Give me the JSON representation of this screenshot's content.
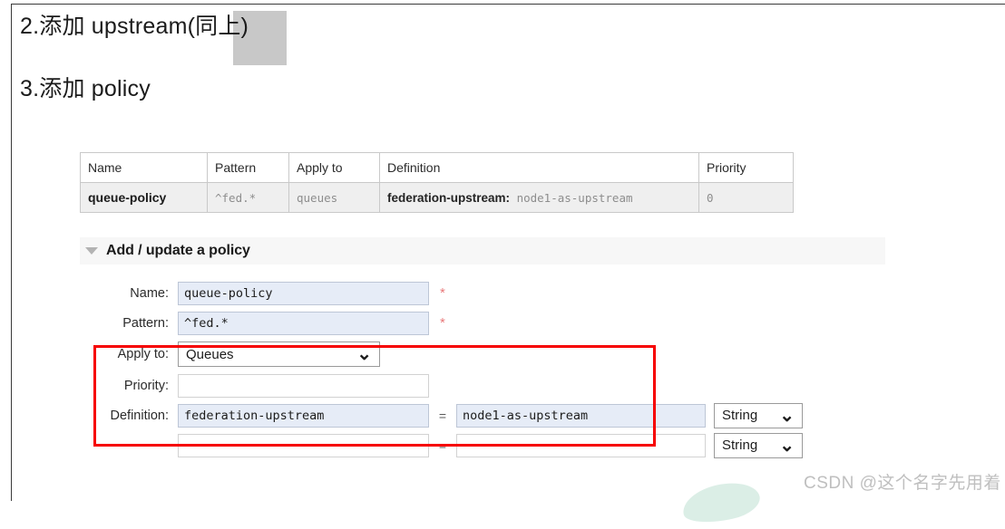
{
  "document": {
    "heading_2": "2.添加 upstream(同上)",
    "heading_2_highlight": "同上",
    "heading_3": "3.添加 policy"
  },
  "policy_table": {
    "headers": [
      "Name",
      "Pattern",
      "Apply to",
      "Definition",
      "Priority"
    ],
    "rows": [
      {
        "name": "queue-policy",
        "pattern": "^fed.*",
        "apply_to": "queues",
        "definition_key": "federation-upstream:",
        "definition_value": "node1-as-upstream",
        "priority": "0"
      }
    ]
  },
  "section": {
    "caret_icon": "triangle-down-icon",
    "title": "Add / update a policy"
  },
  "form": {
    "name": {
      "label": "Name:",
      "value": "queue-policy",
      "required_marker": "*"
    },
    "pattern": {
      "label": "Pattern:",
      "value": "^fed.*",
      "required_marker": "*"
    },
    "apply_to": {
      "label": "Apply to:",
      "value": "Queues",
      "options": [
        "Queues"
      ],
      "chevron_icon": "chevron-down-icon"
    },
    "priority": {
      "label": "Priority:",
      "value": "",
      "placeholder": ""
    },
    "definition": {
      "label": "Definition:",
      "equals": "=",
      "rows": [
        {
          "key": "federation-upstream",
          "value": "node1-as-upstream",
          "type": "String",
          "type_options": [
            "String"
          ]
        },
        {
          "key": "",
          "value": "",
          "type": "String",
          "type_options": [
            "String"
          ]
        }
      ]
    }
  },
  "annotation": {
    "highlight_color": "#f60000"
  },
  "watermark": {
    "text": "CSDN @这个名字先用着"
  }
}
